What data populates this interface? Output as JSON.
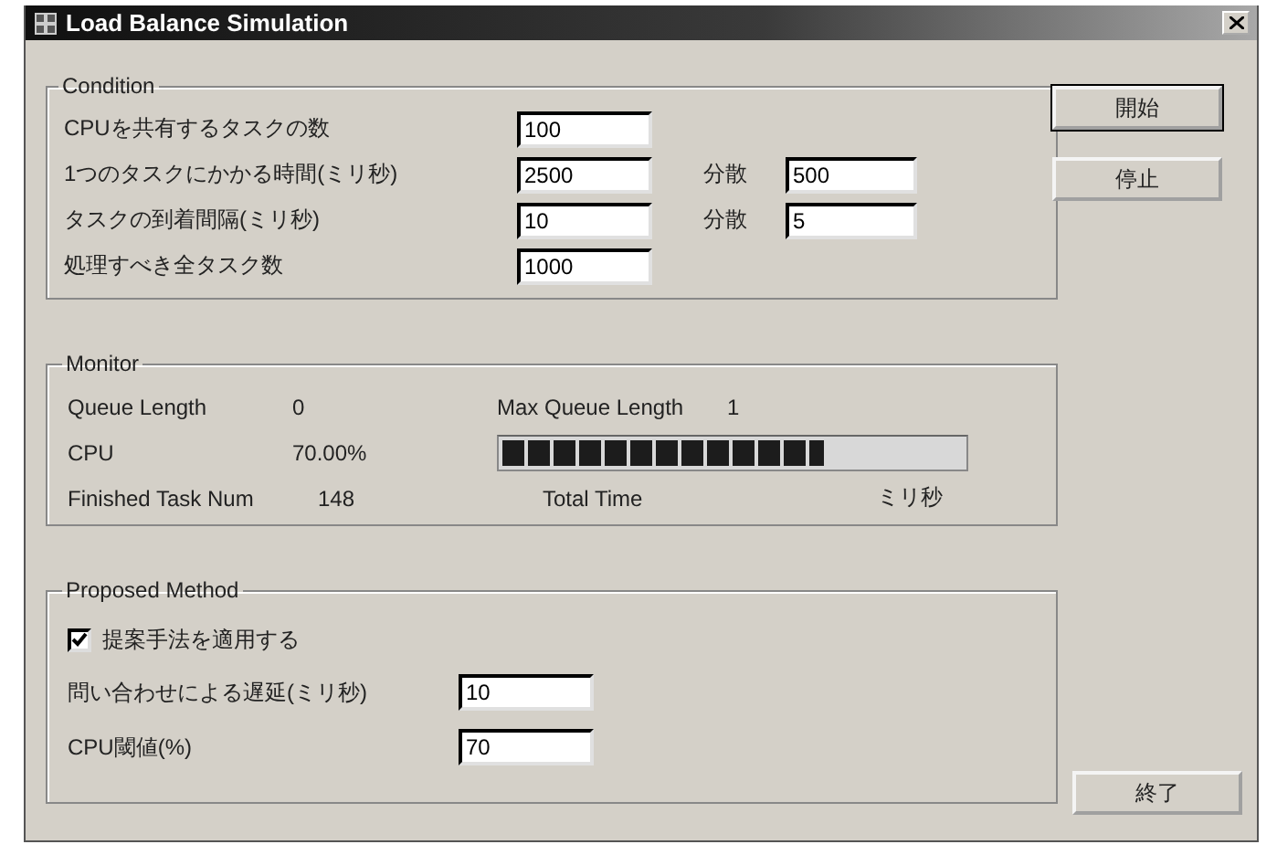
{
  "window": {
    "title": "Load Balance Simulation"
  },
  "condition": {
    "legend": "Condition",
    "rows": [
      {
        "label": "CPUを共有するタスクの数",
        "value": "100"
      },
      {
        "label": "1つのタスクにかかる時間(ミリ秒)",
        "value": "2500",
        "variance_label": "分散",
        "variance_value": "500"
      },
      {
        "label": "タスクの到着間隔(ミリ秒)",
        "value": "10",
        "variance_label": "分散",
        "variance_value": "5"
      },
      {
        "label": "処理すべき全タスク数",
        "value": "1000"
      }
    ]
  },
  "monitor": {
    "legend": "Monitor",
    "queue_length_label": "Queue Length",
    "queue_length": "0",
    "max_queue_length_label": "Max Queue Length",
    "max_queue_length": "1",
    "cpu_label": "CPU",
    "cpu_value": "70.00%",
    "level": 0.7,
    "finished_label": "Finished Task Num",
    "finished_value": "148",
    "total_time_label": "Total Time",
    "total_time_unit": "ミリ秒"
  },
  "proposed": {
    "legend": "Proposed Method",
    "checkbox": {
      "label": "提案手法を適用する",
      "checked": true
    },
    "rows": [
      {
        "label": "問い合わせによる遅延(ミリ秒)",
        "value": "10"
      },
      {
        "label": "CPU閾値(%)",
        "value": "70"
      }
    ]
  },
  "buttons": [
    {
      "label": "開始",
      "default": true
    },
    {
      "label": "停止",
      "default": false
    }
  ],
  "exit_button": {
    "label": "終了"
  }
}
